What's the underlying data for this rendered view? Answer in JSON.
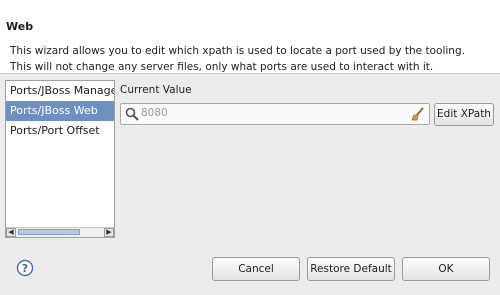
{
  "header": {
    "title": "Web",
    "description_lines": [
      "This wizard allows you to edit which xpath is used to locate a port used by the tooling.",
      "This will not change any server files, only what ports are used to interact with it."
    ]
  },
  "ports": {
    "items": [
      {
        "label": "Ports/JBoss Manager",
        "selected": false
      },
      {
        "label": "Ports/JBoss Web",
        "selected": true
      },
      {
        "label": "Ports/Port Offset",
        "selected": false
      }
    ]
  },
  "current": {
    "label": "Current Value",
    "value": "8080",
    "edit_label": "Edit XPath"
  },
  "footer": {
    "cancel_label": "Cancel",
    "restore_label": "Restore Default",
    "ok_label": "OK"
  },
  "icons": {
    "help": "help-icon",
    "search": "search-icon",
    "clear": "brush-icon"
  },
  "colors": {
    "selection": "#6e8fbf"
  }
}
